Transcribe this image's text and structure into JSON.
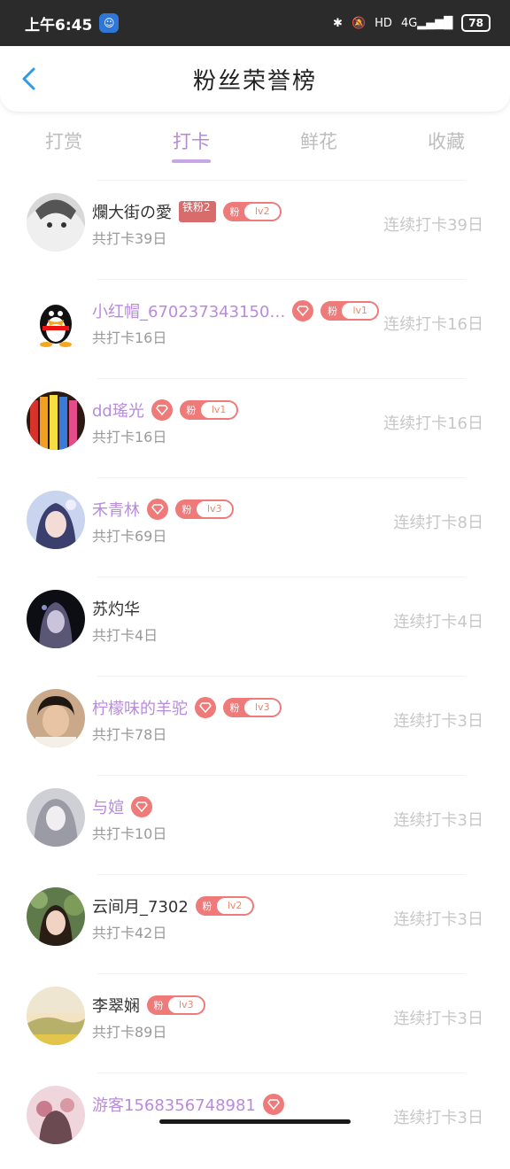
{
  "status": {
    "time": "上午6:45",
    "net": "4G",
    "battery": "78",
    "hd": "HD"
  },
  "header": {
    "title": "粉丝荣誉榜"
  },
  "tabs": [
    {
      "label": "打赏"
    },
    {
      "label": "打卡"
    },
    {
      "label": "鲜花"
    },
    {
      "label": "收藏"
    }
  ],
  "active_tab": "打卡",
  "colors": {
    "accent": "#b48cd6",
    "badge": "#ef7a7a",
    "muted": "#c7c7c7"
  },
  "rows": [
    {
      "name": "爛大街の愛",
      "sub": "共打卡39日",
      "streak": "连续打卡39日",
      "ironfan": "铁粉2",
      "level": "lv2",
      "fan": "粉"
    },
    {
      "name": "小红帽_670237343150…",
      "sub": "共打卡16日",
      "streak": "连续打卡16日",
      "level": "lv1",
      "fan": "粉"
    },
    {
      "name": "dd瑤光",
      "sub": "共打卡16日",
      "streak": "连续打卡16日",
      "level": "lv1",
      "fan": "粉"
    },
    {
      "name": "禾青林",
      "sub": "共打卡69日",
      "streak": "连续打卡8日",
      "level": "lv3",
      "fan": "粉"
    },
    {
      "name": "苏灼华",
      "sub": "共打卡4日",
      "streak": "连续打卡4日"
    },
    {
      "name": "柠檬味的羊驼",
      "sub": "共打卡78日",
      "streak": "连续打卡3日",
      "level": "lv3",
      "fan": "粉"
    },
    {
      "name": "与媗",
      "sub": "共打卡10日",
      "streak": "连续打卡3日"
    },
    {
      "name": "云间月_7302",
      "sub": "共打卡42日",
      "streak": "连续打卡3日",
      "level": "lv2",
      "fan": "粉"
    },
    {
      "name": "李翠娴",
      "sub": "共打卡89日",
      "streak": "连续打卡3日",
      "level": "lv3",
      "fan": "粉"
    },
    {
      "name": "游客1568356748981",
      "sub": "",
      "streak": "连续打卡3日"
    }
  ]
}
